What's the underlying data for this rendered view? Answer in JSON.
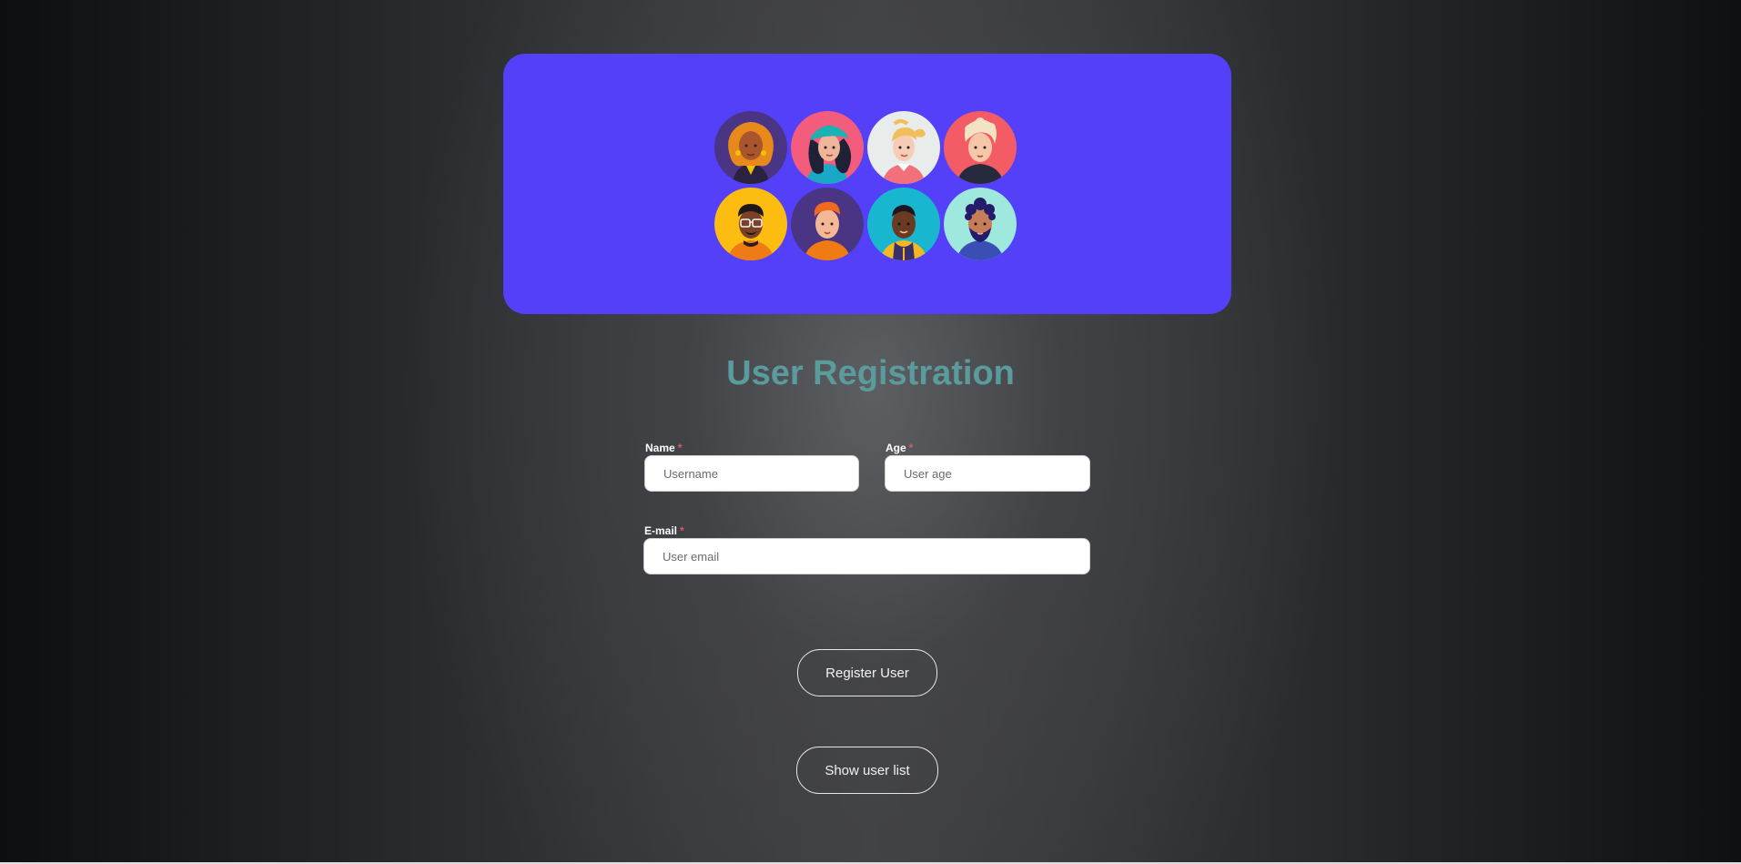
{
  "form": {
    "title": "User Registration",
    "name": {
      "label": "Name",
      "required_mark": "*",
      "placeholder": "Username",
      "value": ""
    },
    "age": {
      "label": "Age",
      "required_mark": "*",
      "placeholder": "User age",
      "value": ""
    },
    "email": {
      "label": "E-mail",
      "required_mark": "*",
      "placeholder": "User email",
      "value": ""
    }
  },
  "buttons": {
    "register_label": "Register User",
    "show_list_label": "Show user list"
  },
  "colors": {
    "hero_background": "#5440f8",
    "title": "#5a9b9e",
    "required_mark": "#e05a5a"
  },
  "hero": {
    "avatars": [
      "avatar-woman-orange-curly-hair-icon",
      "avatar-woman-teal-cap-icon",
      "avatar-woman-blonde-ponytail-icon",
      "avatar-man-blonde-curly-hair-icon",
      "avatar-man-glasses-icon",
      "avatar-man-ginger-hair-icon",
      "avatar-man-yellow-jacket-icon",
      "avatar-man-beard-icon"
    ]
  }
}
